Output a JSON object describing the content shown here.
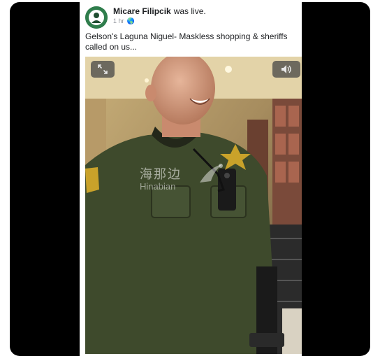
{
  "post": {
    "author": "Micare Filipcik",
    "action": "was live.",
    "time": "1 hr",
    "privacy_icon": "globe-icon",
    "text": "Gelson's Laguna Niguel- Maskless shopping & sheriffs called on us..."
  },
  "video": {
    "fullscreen_icon": "expand-icon",
    "volume_icon": "speaker-icon",
    "watermark_zh": "海那边",
    "watermark_en": "Hinabian"
  },
  "colors": {
    "frame": "#000000",
    "avatar_bg": "#2f7d4c",
    "uniform": "#3e4a2c",
    "badge": "#c9a22a"
  }
}
